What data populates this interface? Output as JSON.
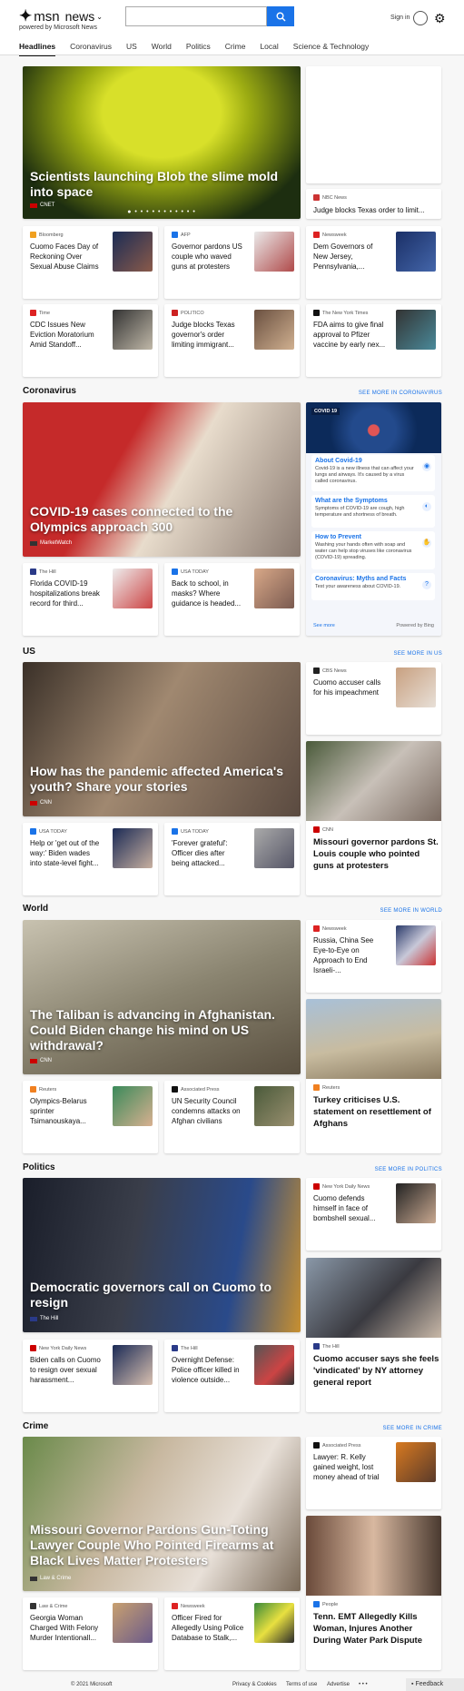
{
  "brand": {
    "name": "msn",
    "section": "news",
    "powered": "powered by Microsoft News"
  },
  "search": {
    "value": ""
  },
  "header": {
    "signin": "Sign in"
  },
  "nav": [
    "Headlines",
    "Coronavirus",
    "US",
    "World",
    "Politics",
    "Crime",
    "Local",
    "Science & Technology"
  ],
  "headlines": {
    "hero": {
      "title": "Scientists launching Blob the slime mold into space",
      "source": "CNET"
    },
    "side": {
      "source": "NBC News",
      "title": "Judge blocks Texas order to limit..."
    },
    "row1": [
      {
        "source": "Bloomberg",
        "title": "Cuomo Faces Day of Reckoning Over Sexual Abuse Claims"
      },
      {
        "source": "AFP",
        "title": "Governor pardons US couple who waved guns at protesters"
      },
      {
        "source": "Newsweek",
        "title": "Dem Governors of New Jersey, Pennsylvania,..."
      }
    ],
    "row2": [
      {
        "source": "Time",
        "title": "CDC Issues New Eviction Moratorium Amid Standoff..."
      },
      {
        "source": "POLITICO",
        "title": "Judge blocks Texas governor's order limiting immigrant..."
      },
      {
        "source": "The New York Times",
        "title": "FDA aims to give final approval to Pfizer vaccine by early nex..."
      }
    ]
  },
  "coronavirus": {
    "heading": "Coronavirus",
    "more": "SEE MORE IN CORONAVIRUS",
    "hero": {
      "title": "COVID-19 cases connected to the Olympics approach 300",
      "source": "MarketWatch"
    },
    "row": [
      {
        "source": "The Hill",
        "title": "Florida COVID-19 hospitalizations break record for third..."
      },
      {
        "source": "USA TODAY",
        "title": "Back to school, in masks? Where guidance is headed..."
      }
    ],
    "panel": {
      "tag": "COVID 19",
      "items": [
        {
          "title": "About Covid-19",
          "desc": "Covid-19 is a new illness that can affect your lungs and airways. It's caused by a virus called coronavirus."
        },
        {
          "title": "What are the Symptoms",
          "desc": "Symptoms of COVID-19 are cough, high temperature and shortness of breath."
        },
        {
          "title": "How to Prevent",
          "desc": "Washing your hands often with soap and water can help stop viruses like coronavirus (COVID-19) spreading."
        },
        {
          "title": "Coronavirus: Myths and Facts",
          "desc": "Test your awareness about COVID-19."
        }
      ],
      "see_more": "See more",
      "powered": "Powered by Bing"
    }
  },
  "us": {
    "heading": "US",
    "more": "SEE MORE IN US",
    "hero": {
      "title": "How has the pandemic affected America's youth? Share your stories",
      "source": "CNN"
    },
    "side": {
      "source": "CBS News",
      "title": "Cuomo accuser calls for his impeachment"
    },
    "row": [
      {
        "source": "USA TODAY",
        "title": "Help or 'get out of the way:' Biden wades into state-level fight..."
      },
      {
        "source": "USA TODAY",
        "title": "'Forever grateful': Officer dies after being attacked..."
      }
    ],
    "big": {
      "source": "CNN",
      "title": "Missouri governor pardons St. Louis couple who pointed guns at protesters"
    }
  },
  "world": {
    "heading": "World",
    "more": "SEE MORE IN WORLD",
    "hero": {
      "title": "The Taliban is advancing in Afghanistan. Could Biden change his mind on US withdrawal?",
      "source": "CNN"
    },
    "side": {
      "source": "Newsweek",
      "title": "Russia, China See Eye-to-Eye on Approach to End Israeli-..."
    },
    "row": [
      {
        "source": "Reuters",
        "title": "Olympics-Belarus sprinter Tsimanouskaya..."
      },
      {
        "source": "Associated Press",
        "title": "UN Security Council condemns attacks on Afghan civilians"
      }
    ],
    "big": {
      "source": "Reuters",
      "title": "Turkey criticises U.S. statement on resettlement of Afghans"
    }
  },
  "politics": {
    "heading": "Politics",
    "more": "SEE MORE IN POLITICS",
    "hero": {
      "title": "Democratic governors call on Cuomo to resign",
      "source": "The Hill"
    },
    "side": {
      "source": "New York Daily News",
      "title": "Cuomo defends himself in face of bombshell sexual..."
    },
    "row": [
      {
        "source": "New York Daily News",
        "title": "Biden calls on Cuomo to resign over sexual harassment..."
      },
      {
        "source": "The Hill",
        "title": "Overnight Defense: Police officer killed in violence outside..."
      }
    ],
    "big": {
      "source": "The Hill",
      "title": "Cuomo accuser says she feels 'vindicated' by NY attorney general report"
    }
  },
  "crime": {
    "heading": "Crime",
    "more": "SEE MORE IN CRIME",
    "hero": {
      "title": "Missouri Governor Pardons Gun-Toting Lawyer Couple Who Pointed Firearms at Black Lives Matter Protesters",
      "source": "Law & Crime"
    },
    "side": {
      "source": "Associated Press",
      "title": "Lawyer: R. Kelly gained weight, lost money ahead of trial"
    },
    "row": [
      {
        "source": "Law & Crime",
        "title": "Georgia Woman Charged With Felony Murder Intentionall..."
      },
      {
        "source": "Newsweek",
        "title": "Officer Fired for Allegedly Using Police Database to Stalk,..."
      }
    ],
    "big": {
      "source": "People",
      "title": "Tenn. EMT Allegedly Kills Woman, Injures Another During Water Park Dispute"
    }
  },
  "footer": {
    "copyright": "© 2021 Microsoft",
    "links": [
      "Privacy & Cookies",
      "Terms of use",
      "Advertise",
      "• • •"
    ],
    "feedback": "Feedback"
  },
  "colors": {
    "accent": "#1a73e8",
    "card": "#ffffff",
    "page": "#f7f7f7"
  }
}
